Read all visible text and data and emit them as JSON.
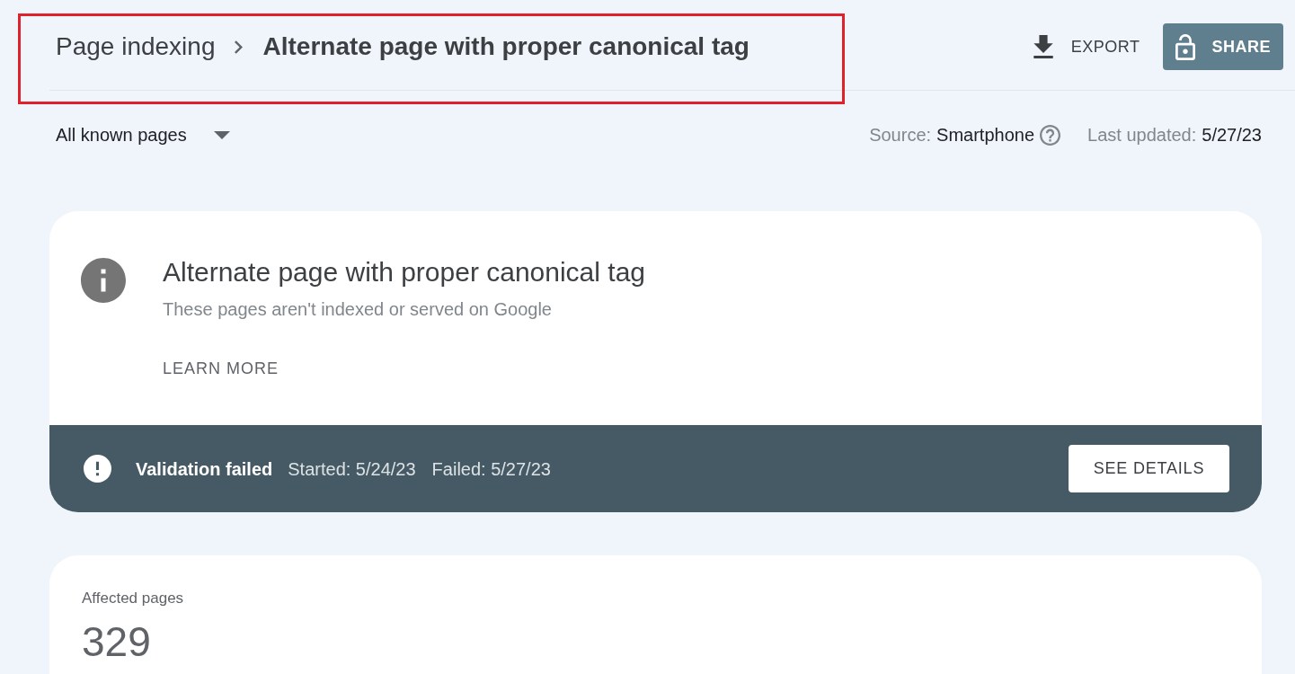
{
  "header": {
    "breadcrumb": {
      "parent": "Page indexing",
      "current": "Alternate page with proper canonical tag",
      "highlighted": true
    },
    "export_button": "EXPORT",
    "share_button": "SHARE"
  },
  "filters": {
    "dropdown": {
      "value": "All known pages"
    },
    "source": {
      "label": "Source:",
      "value": "Smartphone"
    },
    "last_updated": {
      "label": "Last updated:",
      "value": "5/27/23"
    }
  },
  "issue_card": {
    "title": "Alternate page with proper canonical tag",
    "subtitle": "These pages aren't indexed or served on Google",
    "link": "LEARN MORE",
    "validation": {
      "kind": "failed",
      "status": "Validation failed",
      "started": "Started: 5/24/23",
      "failed": "Failed: 5/27/23",
      "button": "SEE DETAILS"
    }
  },
  "affected_card": {
    "label": "Affected pages",
    "count": "329"
  }
}
